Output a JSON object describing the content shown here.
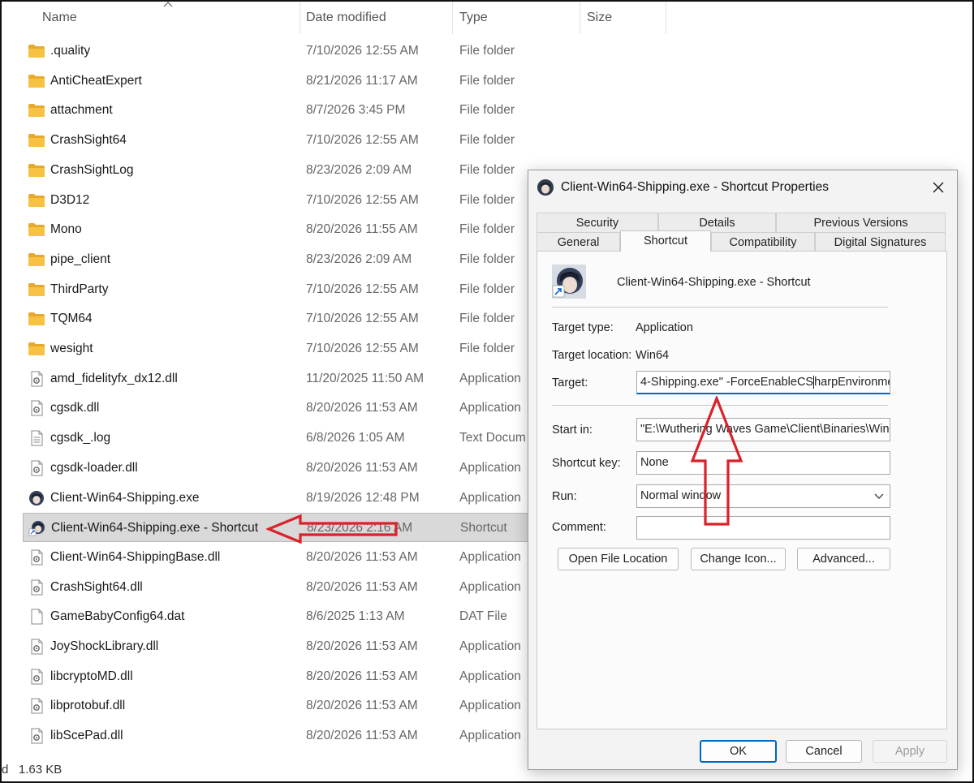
{
  "columns": {
    "name": "Name",
    "date": "Date modified",
    "type": "Type",
    "size": "Size"
  },
  "files": [
    {
      "name": ".quality",
      "date": "7/10/2026 12:55 AM",
      "type": "File folder",
      "icon": "folder-icon"
    },
    {
      "name": "AntiCheatExpert",
      "date": "8/21/2026 11:17 AM",
      "type": "File folder",
      "icon": "folder-icon"
    },
    {
      "name": "attachment",
      "date": "8/7/2026 3:45 PM",
      "type": "File folder",
      "icon": "folder-icon"
    },
    {
      "name": "CrashSight64",
      "date": "7/10/2026 12:55 AM",
      "type": "File folder",
      "icon": "folder-icon"
    },
    {
      "name": "CrashSightLog",
      "date": "8/23/2026 2:09 AM",
      "type": "File folder",
      "icon": "folder-icon"
    },
    {
      "name": "D3D12",
      "date": "7/10/2026 12:55 AM",
      "type": "File folder",
      "icon": "folder-icon"
    },
    {
      "name": "Mono",
      "date": "8/20/2026 11:55 AM",
      "type": "File folder",
      "icon": "folder-icon"
    },
    {
      "name": "pipe_client",
      "date": "8/23/2026 2:09 AM",
      "type": "File folder",
      "icon": "folder-icon"
    },
    {
      "name": "ThirdParty",
      "date": "7/10/2026 12:55 AM",
      "type": "File folder",
      "icon": "folder-icon"
    },
    {
      "name": "TQM64",
      "date": "7/10/2026 12:55 AM",
      "type": "File folder",
      "icon": "folder-icon"
    },
    {
      "name": "wesight",
      "date": "7/10/2026 12:55 AM",
      "type": "File folder",
      "icon": "folder-icon"
    },
    {
      "name": "amd_fidelityfx_dx12.dll",
      "date": "11/20/2025 11:50 AM",
      "type": "Application",
      "icon": "dll-file-icon"
    },
    {
      "name": "cgsdk.dll",
      "date": "8/20/2026 11:53 AM",
      "type": "Application",
      "icon": "dll-file-icon"
    },
    {
      "name": "cgsdk_.log",
      "date": "6/8/2026 1:05 AM",
      "type": "Text Docum",
      "icon": "text-file-icon"
    },
    {
      "name": "cgsdk-loader.dll",
      "date": "8/20/2026 11:53 AM",
      "type": "Application",
      "icon": "dll-file-icon"
    },
    {
      "name": "Client-Win64-Shipping.exe",
      "date": "8/19/2026 12:48 PM",
      "type": "Application",
      "icon": "game-app-icon"
    },
    {
      "name": "Client-Win64-Shipping.exe - Shortcut",
      "date": "8/23/2026 2:16 AM",
      "type": "Shortcut",
      "icon": "shortcut-icon",
      "selected": true
    },
    {
      "name": "Client-Win64-ShippingBase.dll",
      "date": "8/20/2026 11:53 AM",
      "type": "Application",
      "icon": "dll-file-icon"
    },
    {
      "name": "CrashSight64.dll",
      "date": "8/20/2026 11:53 AM",
      "type": "Application",
      "icon": "dll-file-icon"
    },
    {
      "name": "GameBabyConfig64.dat",
      "date": "8/6/2025 1:13 AM",
      "type": "DAT File",
      "icon": "blank-file-icon"
    },
    {
      "name": "JoyShockLibrary.dll",
      "date": "8/20/2026 11:53 AM",
      "type": "Application",
      "icon": "dll-file-icon"
    },
    {
      "name": "libcryptoMD.dll",
      "date": "8/20/2026 11:53 AM",
      "type": "Application",
      "icon": "dll-file-icon"
    },
    {
      "name": "libprotobuf.dll",
      "date": "8/20/2026 11:53 AM",
      "type": "Application",
      "icon": "dll-file-icon"
    },
    {
      "name": "libScePad.dll",
      "date": "8/20/2026 11:53 AM",
      "type": "Application",
      "icon": "dll-file-icon"
    }
  ],
  "statusbar": {
    "prefix": "d",
    "size": "1.63 KB"
  },
  "dialog": {
    "title": "Client-Win64-Shipping.exe - Shortcut Properties",
    "tabs_top": [
      "Security",
      "Details",
      "Previous Versions"
    ],
    "tabs_bottom": [
      "General",
      "Shortcut",
      "Compatibility",
      "Digital Signatures"
    ],
    "active_tab": "Shortcut",
    "shortcut_name": "Client-Win64-Shipping.exe - Shortcut",
    "target_type_label": "Target type:",
    "target_type": "Application",
    "target_location_label": "Target location:",
    "target_location": "Win64",
    "target_label": "Target:",
    "target_before_caret": "4-Shipping.exe\" -ForceEnableCS",
    "target_after_caret": "harpEnvironment",
    "start_in_label": "Start in:",
    "start_in": "\"E:\\Wuthering Waves Game\\Client\\Binaries\\Win",
    "shortcut_key_label": "Shortcut key:",
    "shortcut_key": "None",
    "run_label": "Run:",
    "run": "Normal window",
    "comment_label": "Comment:",
    "comment": "",
    "btn_open_location": "Open File Location",
    "btn_change_icon": "Change Icon...",
    "btn_advanced": "Advanced...",
    "btn_ok": "OK",
    "btn_cancel": "Cancel",
    "btn_apply": "Apply"
  },
  "colors": {
    "folder": "#f7c244",
    "selection": "#d9d9d9",
    "accent": "#0067c0",
    "annotation_arrow": "#d9222a"
  }
}
